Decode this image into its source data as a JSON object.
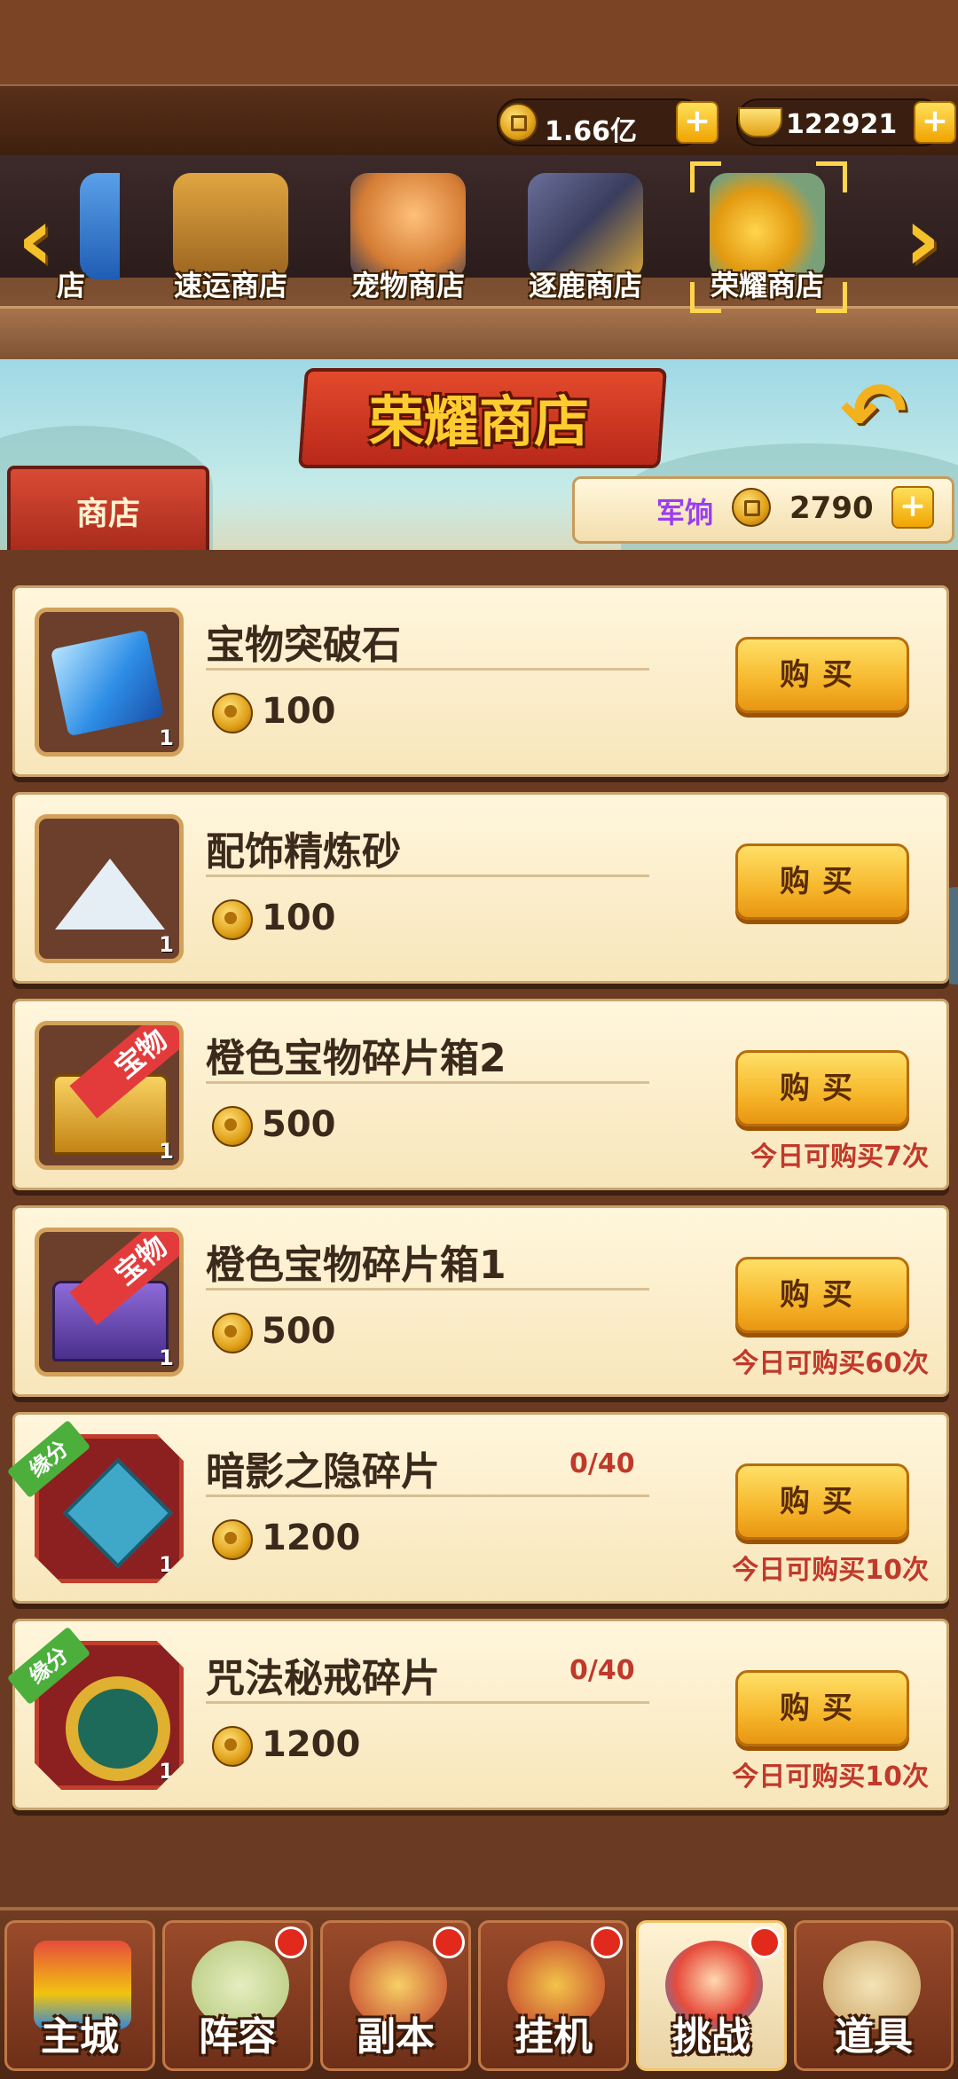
{
  "resources": {
    "gold": "1.66亿",
    "ingot": "122921"
  },
  "shop_tabs": [
    {
      "label": "店"
    },
    {
      "label": "速运商店"
    },
    {
      "label": "宠物商店"
    },
    {
      "label": "逐鹿商店"
    },
    {
      "label": "荣耀商店"
    }
  ],
  "title": "荣耀商店",
  "tab_label": "商店",
  "currency": {
    "label": "军饷",
    "value": "2790"
  },
  "buy_label": "购买",
  "items": [
    {
      "name": "宝物突破石",
      "price": "100",
      "qty": "1",
      "progress": "",
      "limit": "",
      "ribbon": "",
      "tag": ""
    },
    {
      "name": "配饰精炼砂",
      "price": "100",
      "qty": "1",
      "progress": "",
      "limit": "",
      "ribbon": "",
      "tag": ""
    },
    {
      "name": "橙色宝物碎片箱2",
      "price": "500",
      "qty": "1",
      "progress": "",
      "limit": "今日可购买7次",
      "ribbon": "宝物",
      "tag": ""
    },
    {
      "name": "橙色宝物碎片箱1",
      "price": "500",
      "qty": "1",
      "progress": "",
      "limit": "今日可购买60次",
      "ribbon": "宝物",
      "tag": ""
    },
    {
      "name": "暗影之隐碎片",
      "price": "1200",
      "qty": "1",
      "progress": "0/40",
      "limit": "今日可购买10次",
      "ribbon": "",
      "tag": "缘分"
    },
    {
      "name": "咒法秘戒碎片",
      "price": "1200",
      "qty": "1",
      "progress": "0/40",
      "limit": "今日可购买10次",
      "ribbon": "",
      "tag": "缘分"
    }
  ],
  "nav": [
    {
      "label": "主城"
    },
    {
      "label": "阵容"
    },
    {
      "label": "副本"
    },
    {
      "label": "挂机"
    },
    {
      "label": "挑战"
    },
    {
      "label": "道具"
    }
  ],
  "colors": {
    "accent": "#f6b62b",
    "brand_red": "#c0392b",
    "currency_purple": "#9b3df0"
  }
}
